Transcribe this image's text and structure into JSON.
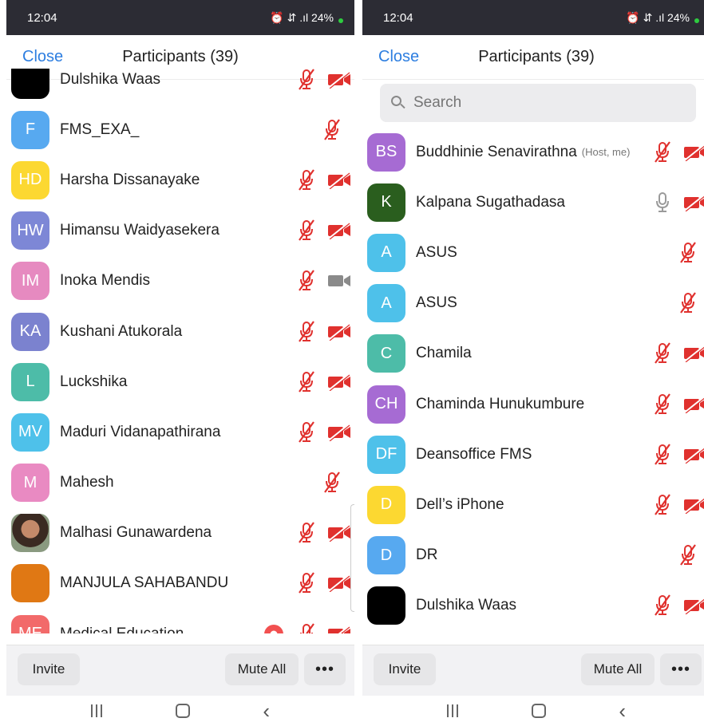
{
  "colors": {
    "accent": "#2d7ee0",
    "muted_icon": "#e0312e",
    "statusbar": "#2c2c34"
  },
  "left": {
    "status": {
      "time": "12:04",
      "icons": "⏰ ⇵ .ıl 24%"
    },
    "header": {
      "close": "Close",
      "title": "Participants (39)"
    },
    "participants": [
      {
        "initials": "",
        "color": "#000000",
        "name": "Dulshika Waas",
        "mic": "muted",
        "cam": "off"
      },
      {
        "initials": "F",
        "color": "#57a9f0",
        "name": "FMS_EXA_",
        "mic": "muted",
        "cam": "none"
      },
      {
        "initials": "HD",
        "color": "#fcd831",
        "name": "Harsha Dissanayake",
        "mic": "muted",
        "cam": "off"
      },
      {
        "initials": "HW",
        "color": "#7d87d6",
        "name": "Himansu Waidyasekera",
        "mic": "muted",
        "cam": "off"
      },
      {
        "initials": "IM",
        "color": "#e68ac0",
        "name": "Inoka Mendis",
        "mic": "muted",
        "cam": "on"
      },
      {
        "initials": "KA",
        "color": "#7b82cf",
        "name": "Kushani Atukorala",
        "mic": "muted",
        "cam": "off"
      },
      {
        "initials": "L",
        "color": "#4dbca8",
        "name": "Luckshika",
        "mic": "muted",
        "cam": "off"
      },
      {
        "initials": "MV",
        "color": "#4ec1ea",
        "name": "Maduri Vidanapathirana",
        "mic": "muted",
        "cam": "off"
      },
      {
        "initials": "M",
        "color": "#e98ac2",
        "name": "Mahesh",
        "mic": "muted",
        "cam": "none"
      },
      {
        "initials": "",
        "color": "photo",
        "name": "Malhasi Gunawardena",
        "mic": "muted",
        "cam": "off"
      },
      {
        "initials": "",
        "color": "#e07814",
        "name": "MANJULA SAHABANDU",
        "mic": "muted",
        "cam": "off"
      },
      {
        "initials": "ME",
        "color": "#f26a6a",
        "name": "Medical Education",
        "mic": "muted",
        "cam": "off",
        "recording": true
      }
    ],
    "footer": {
      "invite": "Invite",
      "mute_all": "Mute All",
      "more": "•••"
    }
  },
  "right": {
    "status": {
      "time": "12:04",
      "icons": "⏰ ⇵ .ıl 24%"
    },
    "header": {
      "close": "Close",
      "title": "Participants (39)"
    },
    "search": {
      "placeholder": "Search"
    },
    "participants": [
      {
        "initials": "BS",
        "color": "#a66bd3",
        "name": "Buddhinie Senavirathna",
        "tag": "(Host, me)",
        "mic": "muted",
        "cam": "off"
      },
      {
        "initials": "K",
        "color": "#2a5e1e",
        "name": "Kalpana Sugathadasa",
        "mic": "on",
        "cam": "off"
      },
      {
        "initials": "A",
        "color": "#4ec1ea",
        "name": "ASUS",
        "mic": "muted",
        "cam": "none"
      },
      {
        "initials": "A",
        "color": "#4ec1ea",
        "name": "ASUS",
        "mic": "muted",
        "cam": "none"
      },
      {
        "initials": "C",
        "color": "#4dbca8",
        "name": "Chamila",
        "mic": "muted",
        "cam": "off"
      },
      {
        "initials": "CH",
        "color": "#a66bd3",
        "name": "Chaminda Hunukumbure",
        "mic": "muted",
        "cam": "off"
      },
      {
        "initials": "DF",
        "color": "#4ec1ea",
        "name": "Deansoffice FMS",
        "mic": "muted",
        "cam": "off"
      },
      {
        "initials": "D",
        "color": "#fcd831",
        "name": "Dell’s iPhone",
        "mic": "muted",
        "cam": "off"
      },
      {
        "initials": "D",
        "color": "#57a9f0",
        "name": "DR",
        "mic": "muted",
        "cam": "none"
      },
      {
        "initials": "",
        "color": "#000000",
        "name": "Dulshika Waas",
        "mic": "muted",
        "cam": "off"
      }
    ],
    "footer": {
      "invite": "Invite",
      "mute_all": "Mute All",
      "more": "•••"
    }
  }
}
